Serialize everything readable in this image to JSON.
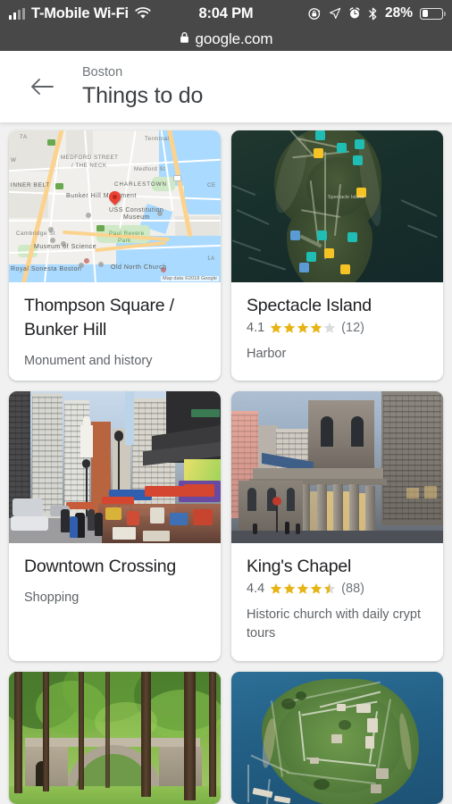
{
  "status_bar": {
    "carrier": "T-Mobile Wi-Fi",
    "time": "8:04 PM",
    "battery_percent": "28%",
    "url": "google.com",
    "icons": {
      "signal": "signal-bars-icon",
      "wifi": "wifi-icon",
      "rotation_lock": "rotation-lock-icon",
      "location": "location-arrow-icon",
      "alarm": "alarm-clock-icon",
      "bluetooth": "bluetooth-icon",
      "battery": "battery-icon",
      "lock": "padlock-icon"
    }
  },
  "header": {
    "back_label": "back-arrow",
    "subtitle": "Boston",
    "title": "Things to do"
  },
  "cards": [
    {
      "name": "Thompson Square / Bunker Hill",
      "category": "Monument and history",
      "rating": null,
      "rating_count": null,
      "image": "map-thumbnail",
      "map": {
        "attribution": "Map data ©2018 Google",
        "labels": [
          "MEDFORD STREET / THE NECK",
          "CHARLESTOWN",
          "Bunker Hill Monument",
          "USS Constitution Museum",
          "Paul Revere Park",
          "Museum of Science",
          "Old North Church",
          "Royal Sonesta Boston",
          "INNER BELT"
        ]
      }
    },
    {
      "name": "Spectacle Island",
      "category": "Harbor",
      "rating": "4.1",
      "rating_count": "(12)",
      "stars_filled": 4,
      "stars_half": 0,
      "image": "satellite-island-thumbnail",
      "map_label": "Spectacle Island"
    },
    {
      "name": "Downtown Crossing",
      "category": "Shopping",
      "rating": null,
      "rating_count": null,
      "image": "street-photo-thumbnail"
    },
    {
      "name": "King's Chapel",
      "category": "Historic church with daily crypt tours",
      "rating": "4.4",
      "rating_count": "(88)",
      "stars_filled": 4,
      "stars_half": 1,
      "image": "chapel-photo-thumbnail"
    },
    {
      "name": "",
      "category": "",
      "image": "forest-bridge-thumbnail"
    },
    {
      "name": "",
      "category": "",
      "image": "fort-island-aerial-thumbnail"
    }
  ],
  "colors": {
    "star_gold": "#e7b416",
    "star_empty": "#dadce0",
    "pin_red": "#ea4335",
    "status_bar_bg": "#484848",
    "page_bg": "#f1f1f1",
    "card_bg": "#ffffff",
    "title_text": "#202124",
    "secondary_text": "#5f6368"
  }
}
